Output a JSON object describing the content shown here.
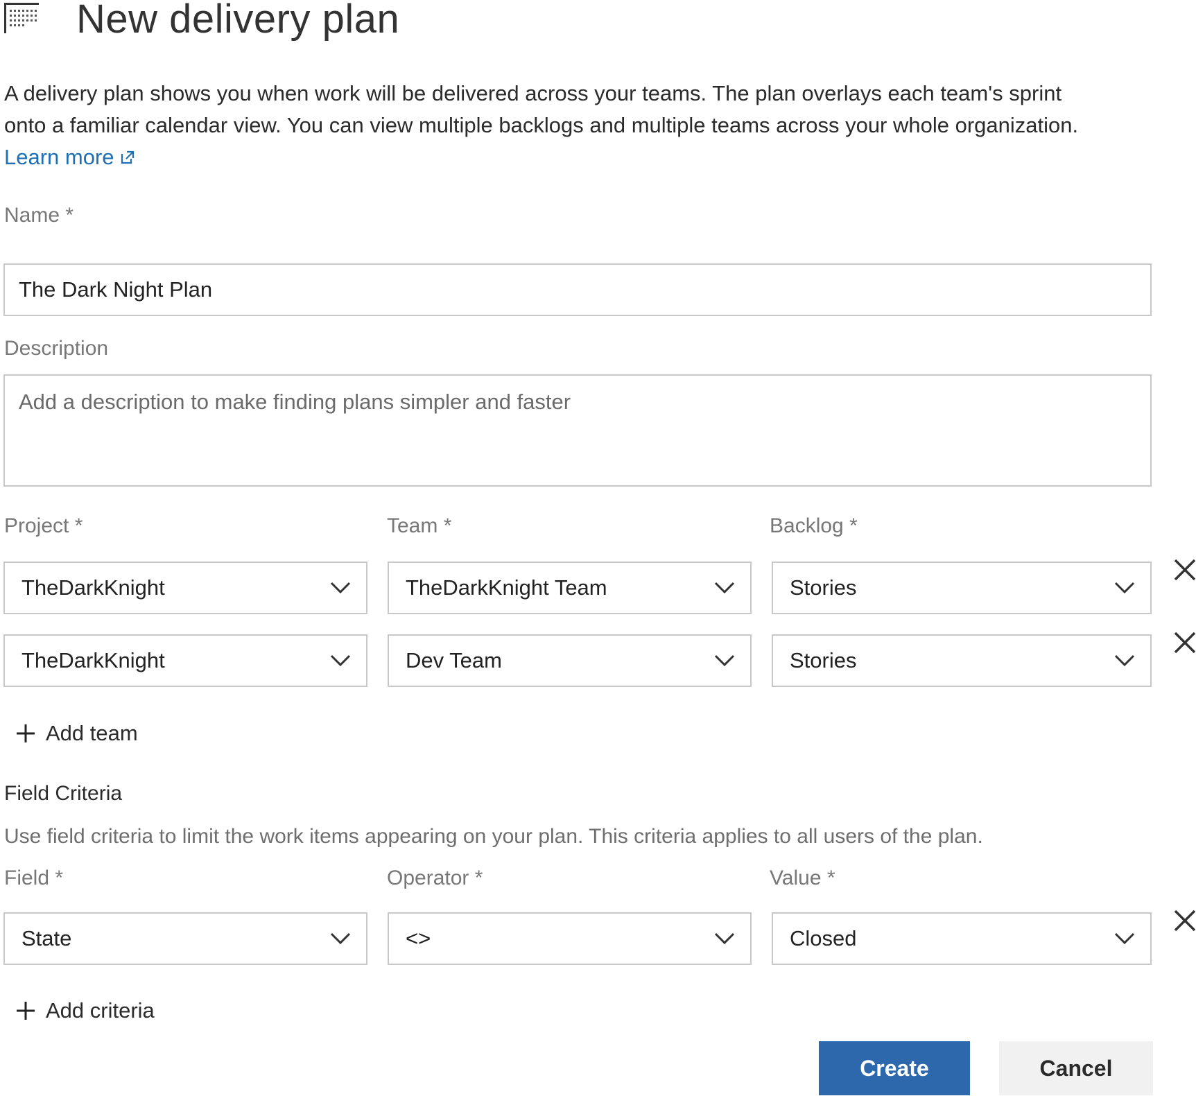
{
  "header": {
    "title": "New delivery plan",
    "icon": "calendar-grid-icon"
  },
  "intro": {
    "line1": "A delivery plan shows you when work will be delivered across your teams. The plan overlays each team's sprint",
    "line2": "onto a familiar calendar view. You can view multiple backlogs and multiple teams across your whole organization.",
    "learn_more": "Learn more"
  },
  "form": {
    "name_label": "Name *",
    "name_value": "The Dark Night Plan",
    "description_label": "Description",
    "description_placeholder": "Add a description to make finding plans simpler and faster",
    "project_label": "Project *",
    "team_label": "Team *",
    "backlog_label": "Backlog *",
    "team_rows": [
      {
        "project": "TheDarkKnight",
        "team": "TheDarkKnight Team",
        "backlog": "Stories"
      },
      {
        "project": "TheDarkKnight",
        "team": "Dev Team",
        "backlog": "Stories"
      }
    ],
    "add_team_label": "Add team",
    "criteria_title": "Field Criteria",
    "criteria_helper": "Use field criteria to limit the work items appearing on your plan. This criteria applies to all users of the plan.",
    "field_label": "Field *",
    "operator_label": "Operator *",
    "value_label": "Value *",
    "criteria_rows": [
      {
        "field": "State",
        "operator": "<>",
        "value": "Closed"
      }
    ],
    "add_criteria_label": "Add criteria"
  },
  "actions": {
    "create_label": "Create",
    "cancel_label": "Cancel"
  },
  "colors": {
    "accent": "#2d68ad",
    "link": "#1f6fb5",
    "border": "#c8c8c8"
  }
}
